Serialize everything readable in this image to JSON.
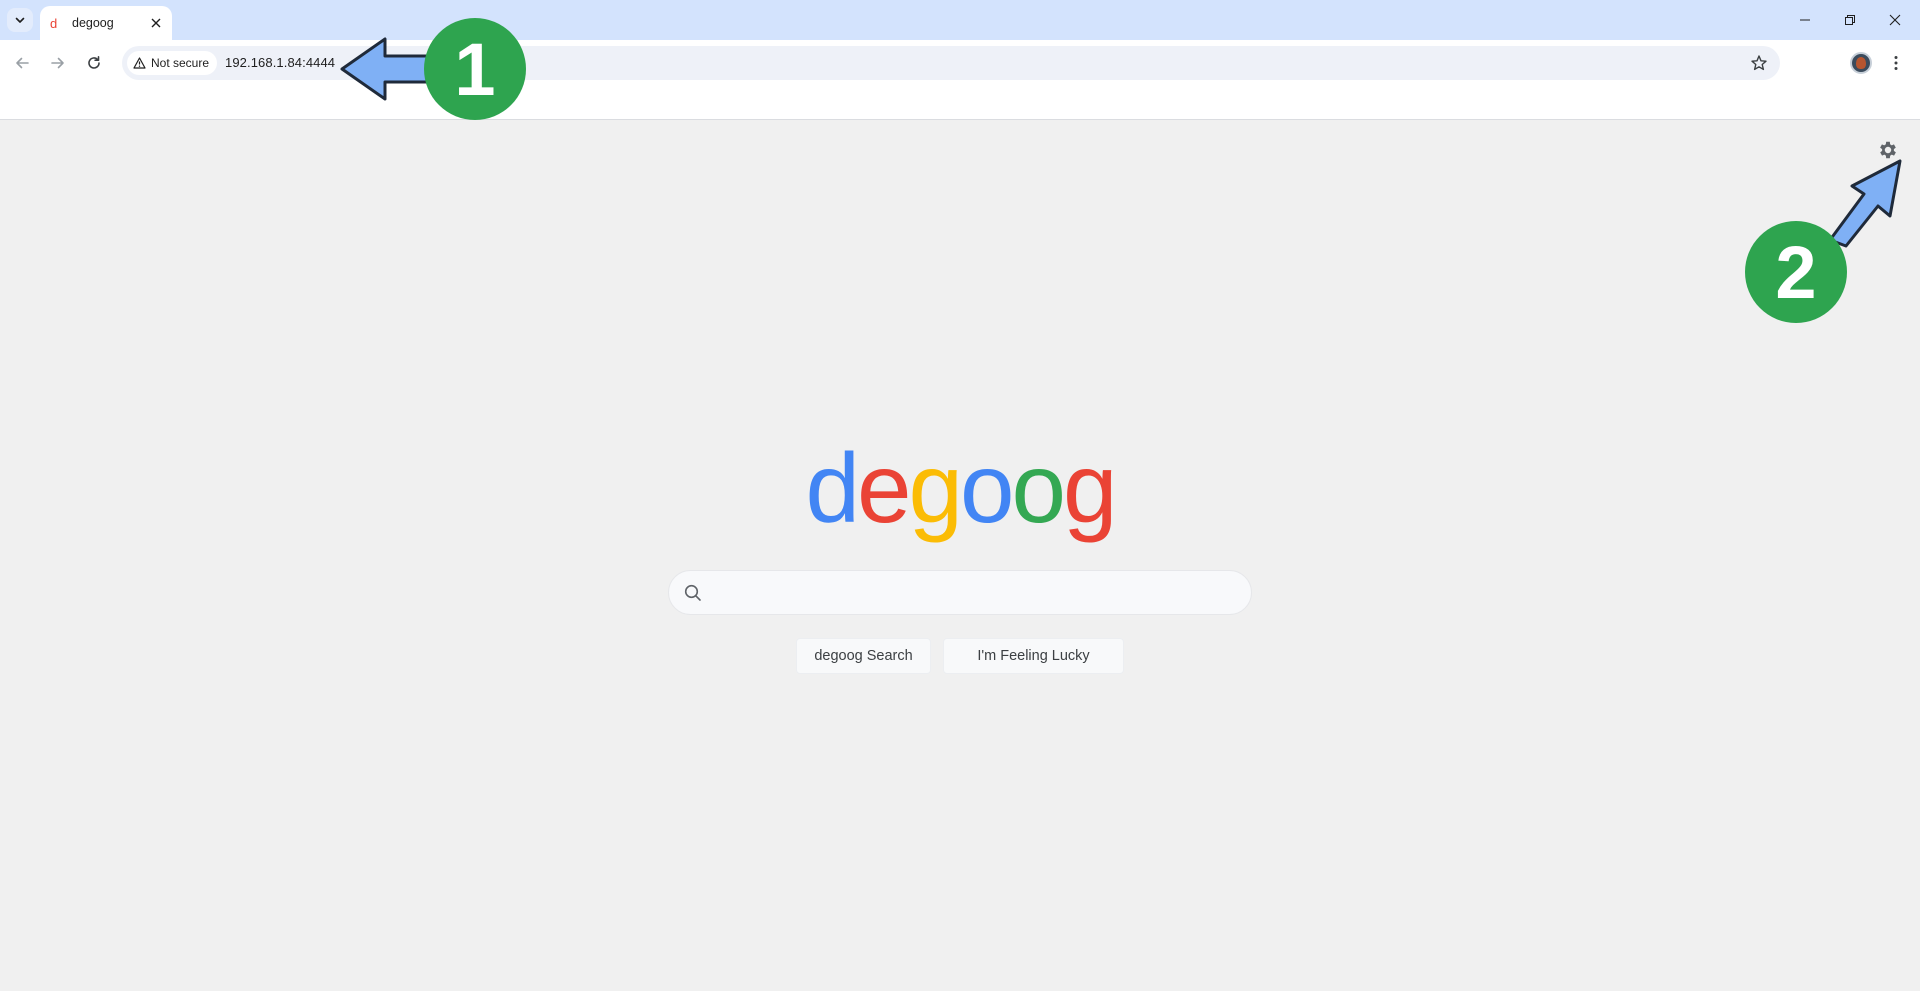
{
  "browser": {
    "tab": {
      "favicon_letter": "d",
      "title": "degoog"
    },
    "address_bar": {
      "security_label": "Not secure",
      "url": "192.168.1.84:4444"
    },
    "icons": {
      "tab_search": "chevron-down-icon",
      "tab_close": "close-icon",
      "back": "arrow-left-icon",
      "forward": "arrow-right-icon",
      "reload": "reload-icon",
      "security": "warning-triangle-icon",
      "bookmark": "star-icon",
      "menu": "kebab-menu-icon",
      "minimize": "minimize-icon",
      "restore": "restore-icon",
      "close_window": "close-icon"
    }
  },
  "page": {
    "logo_letters": [
      {
        "char": "d",
        "color": "#4285f4"
      },
      {
        "char": "e",
        "color": "#ea4335"
      },
      {
        "char": "g",
        "color": "#fbbc05"
      },
      {
        "char": "o",
        "color": "#4285f4"
      },
      {
        "char": "o",
        "color": "#34a853"
      },
      {
        "char": "g",
        "color": "#ea4335"
      }
    ],
    "search": {
      "value": "",
      "placeholder": ""
    },
    "buttons": {
      "search_label": "degoog Search",
      "lucky_label": "I'm Feeling Lucky"
    }
  },
  "annotations": {
    "callout_1": "1",
    "callout_2": "2",
    "circle_color": "#2ea44f",
    "arrow_color": "#7fb0f5"
  }
}
